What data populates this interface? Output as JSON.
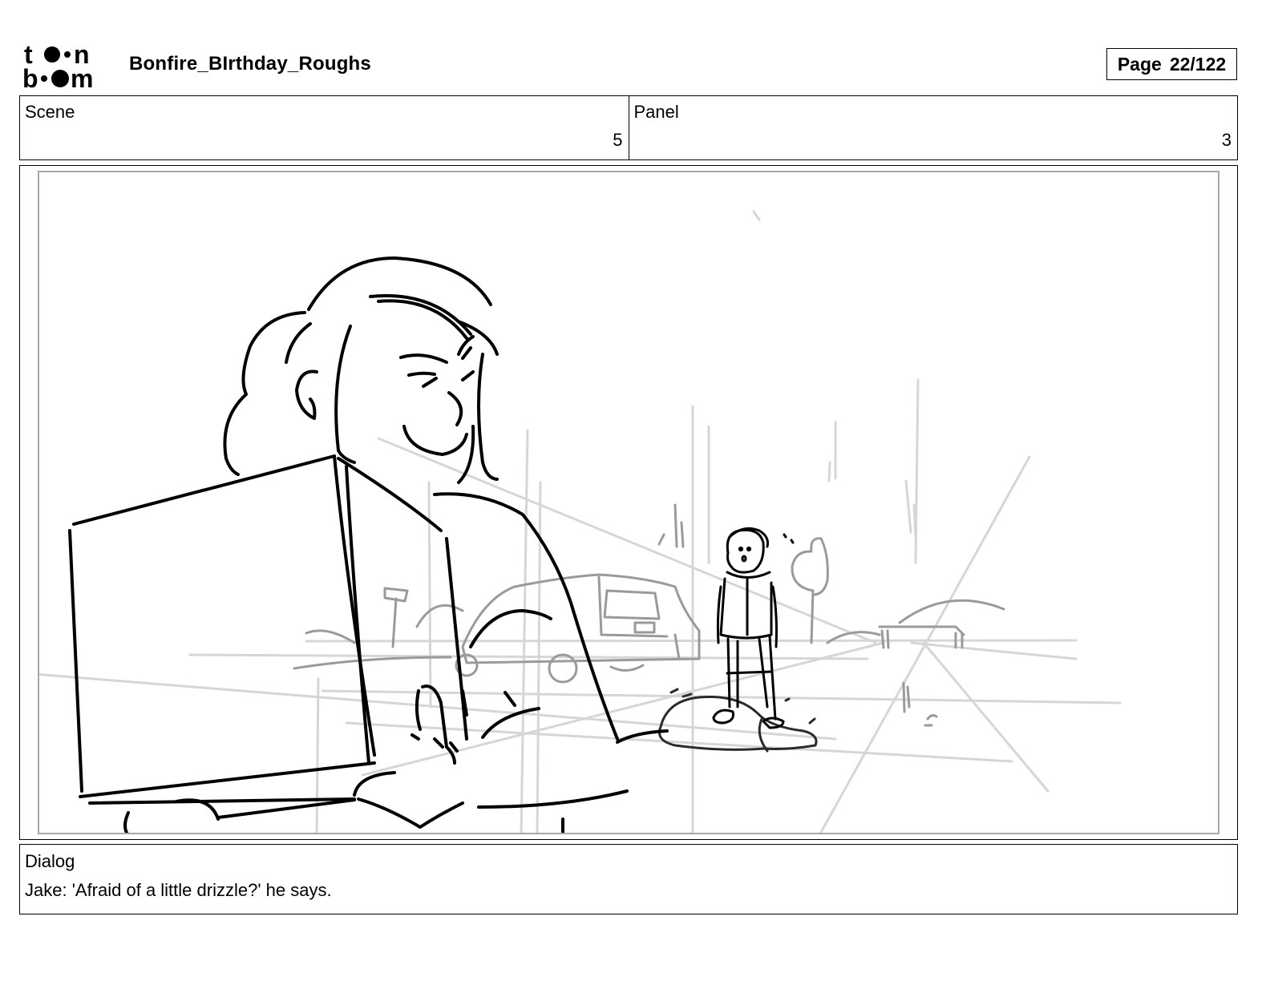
{
  "header": {
    "logo_text": "toon boom",
    "document_title": "Bonfire_BIrthday_Roughs",
    "page_label": "Page",
    "page_number": "22/122"
  },
  "scene": {
    "label": "Scene",
    "value": "5"
  },
  "panel": {
    "label": "Panel",
    "value": "3"
  },
  "dialog": {
    "label": "Dialog",
    "text": "Jake: 'Afraid of a little drizzle?' he says."
  },
  "colors": {
    "ink": "#000000",
    "construction_gray": "#d4d4d4",
    "midground_gray": "#9a9a9a",
    "frame_gray": "#a8a8a8"
  }
}
